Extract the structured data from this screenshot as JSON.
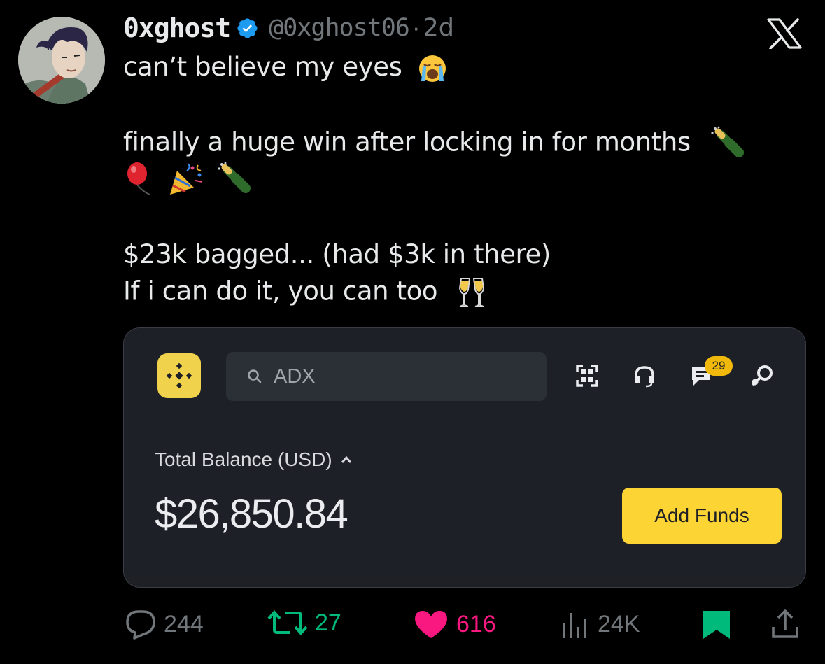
{
  "author": {
    "name": "0xghost",
    "handle": "@0xghost06",
    "separator": "·",
    "time": "2d",
    "verified": true
  },
  "tweet": {
    "line1": "can’t believe my eyes",
    "line1_emoji": "loudly-crying-face",
    "line2": "finally a huge win after locking in for months",
    "line3_emoji": [
      "balloon",
      "party-popper",
      "champagne"
    ],
    "line4": "$23k bagged... (had $3k in there)",
    "line5": "If i can do it, you can too",
    "line5_emoji": "clinking-glasses"
  },
  "card": {
    "search_placeholder": "ADX",
    "notification_count": "29",
    "balance_label": "Total Balance (USD)",
    "balance_value": "$26,850.84",
    "add_funds_label": "Add Funds",
    "colors": {
      "brand_yellow": "#fcd535",
      "card_bg": "#1e2026"
    }
  },
  "actions": {
    "replies": "244",
    "reposts": "27",
    "likes": "616",
    "views": "24K"
  },
  "colors": {
    "repost_green": "#00ba7c",
    "like_pink": "#f91880",
    "muted": "#71767b",
    "verified_blue": "#1d9bf0"
  }
}
